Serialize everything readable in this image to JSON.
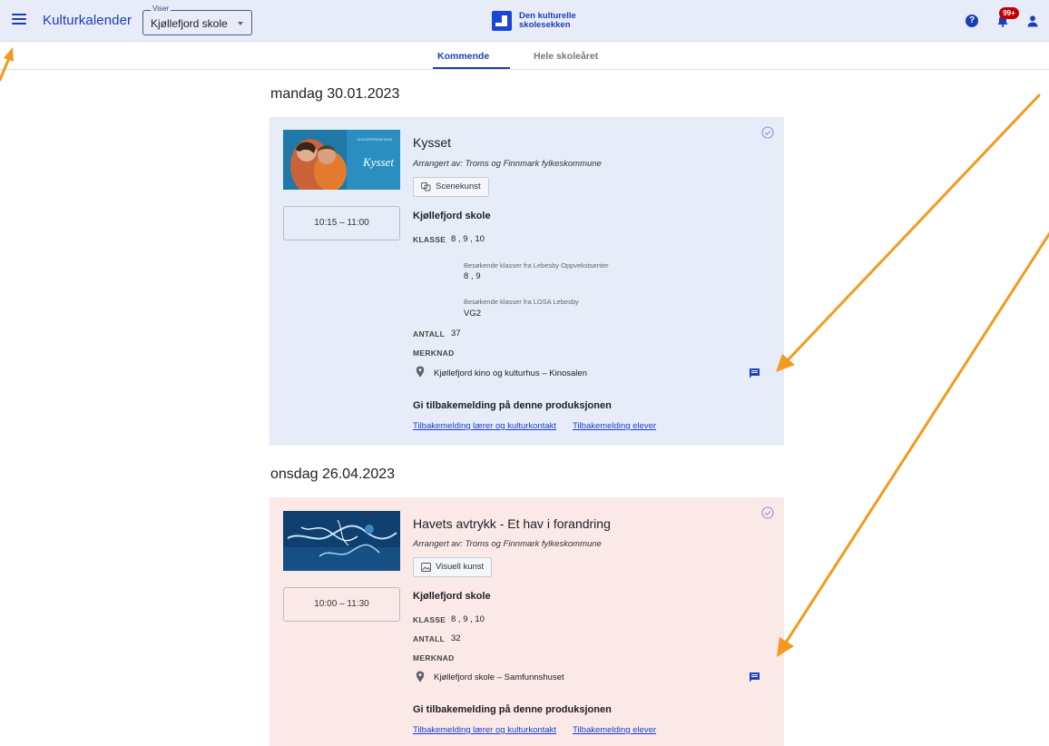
{
  "header": {
    "menu_icon": "hamburger-menu-icon",
    "app_title": "Kulturkalender",
    "viewer_legend": "Viser",
    "viewer_value": "Kjøllefjord skole",
    "brand_line1": "Den kulturelle",
    "brand_line2": "skolesekken",
    "help_label": "?",
    "notification_badge": "99+",
    "accent_color": "#1a3fb3"
  },
  "tabs": {
    "active": "Kommende",
    "other": "Hele skoleåret"
  },
  "events": [
    {
      "date": "mandag 30.01.2023",
      "title": "Kysset",
      "organizer": "Arrangert av: Troms og Finnmark fylkeskommune",
      "category": "Scenekunst",
      "time": "10:15 – 11:00",
      "school": "Kjøllefjord skole",
      "klasse_label": "KLASSE",
      "klasse_value": "8 , 9 , 10",
      "visiting_1_title": "Besøkende klasser fra Lebesby Oppvekstsenter",
      "visiting_1_value": "8 , 9",
      "visiting_2_title": "Besøkende klasser fra LOSA Lebesby",
      "visiting_2_value": "VG2",
      "antall_label": "ANTALL",
      "antall_value": "37",
      "merknad_label": "MERKNAD",
      "location": "Kjøllefjord kino og kulturhus – Kinosalen",
      "feedback_title": "Gi tilbakemelding på denne produksjonen",
      "feedback_link_1": "Tilbakemelding lærer og kulturkontakt",
      "feedback_link_2": "Tilbakemelding elever",
      "poster_text": "Kysset",
      "card_color": "#e6edf8"
    },
    {
      "date": "onsdag 26.04.2023",
      "title": "Havets avtrykk - Et hav i forandring",
      "organizer": "Arrangert av: Troms og Finnmark fylkeskommune",
      "category": "Visuell kunst",
      "time": "10:00 – 11:30",
      "school": "Kjøllefjord skole",
      "klasse_label": "KLASSE",
      "klasse_value": "8 , 9 , 10",
      "antall_label": "ANTALL",
      "antall_value": "32",
      "merknad_label": "MERKNAD",
      "location": "Kjøllefjord skole – Samfunnshuset",
      "feedback_title": "Gi tilbakemelding på denne produksjonen",
      "feedback_link_1": "Tilbakemelding lærer og kulturkontakt",
      "feedback_link_2": "Tilbakemelding elever",
      "card_color": "#fbe9e8"
    }
  ],
  "annotation_color": "#f39a1e"
}
